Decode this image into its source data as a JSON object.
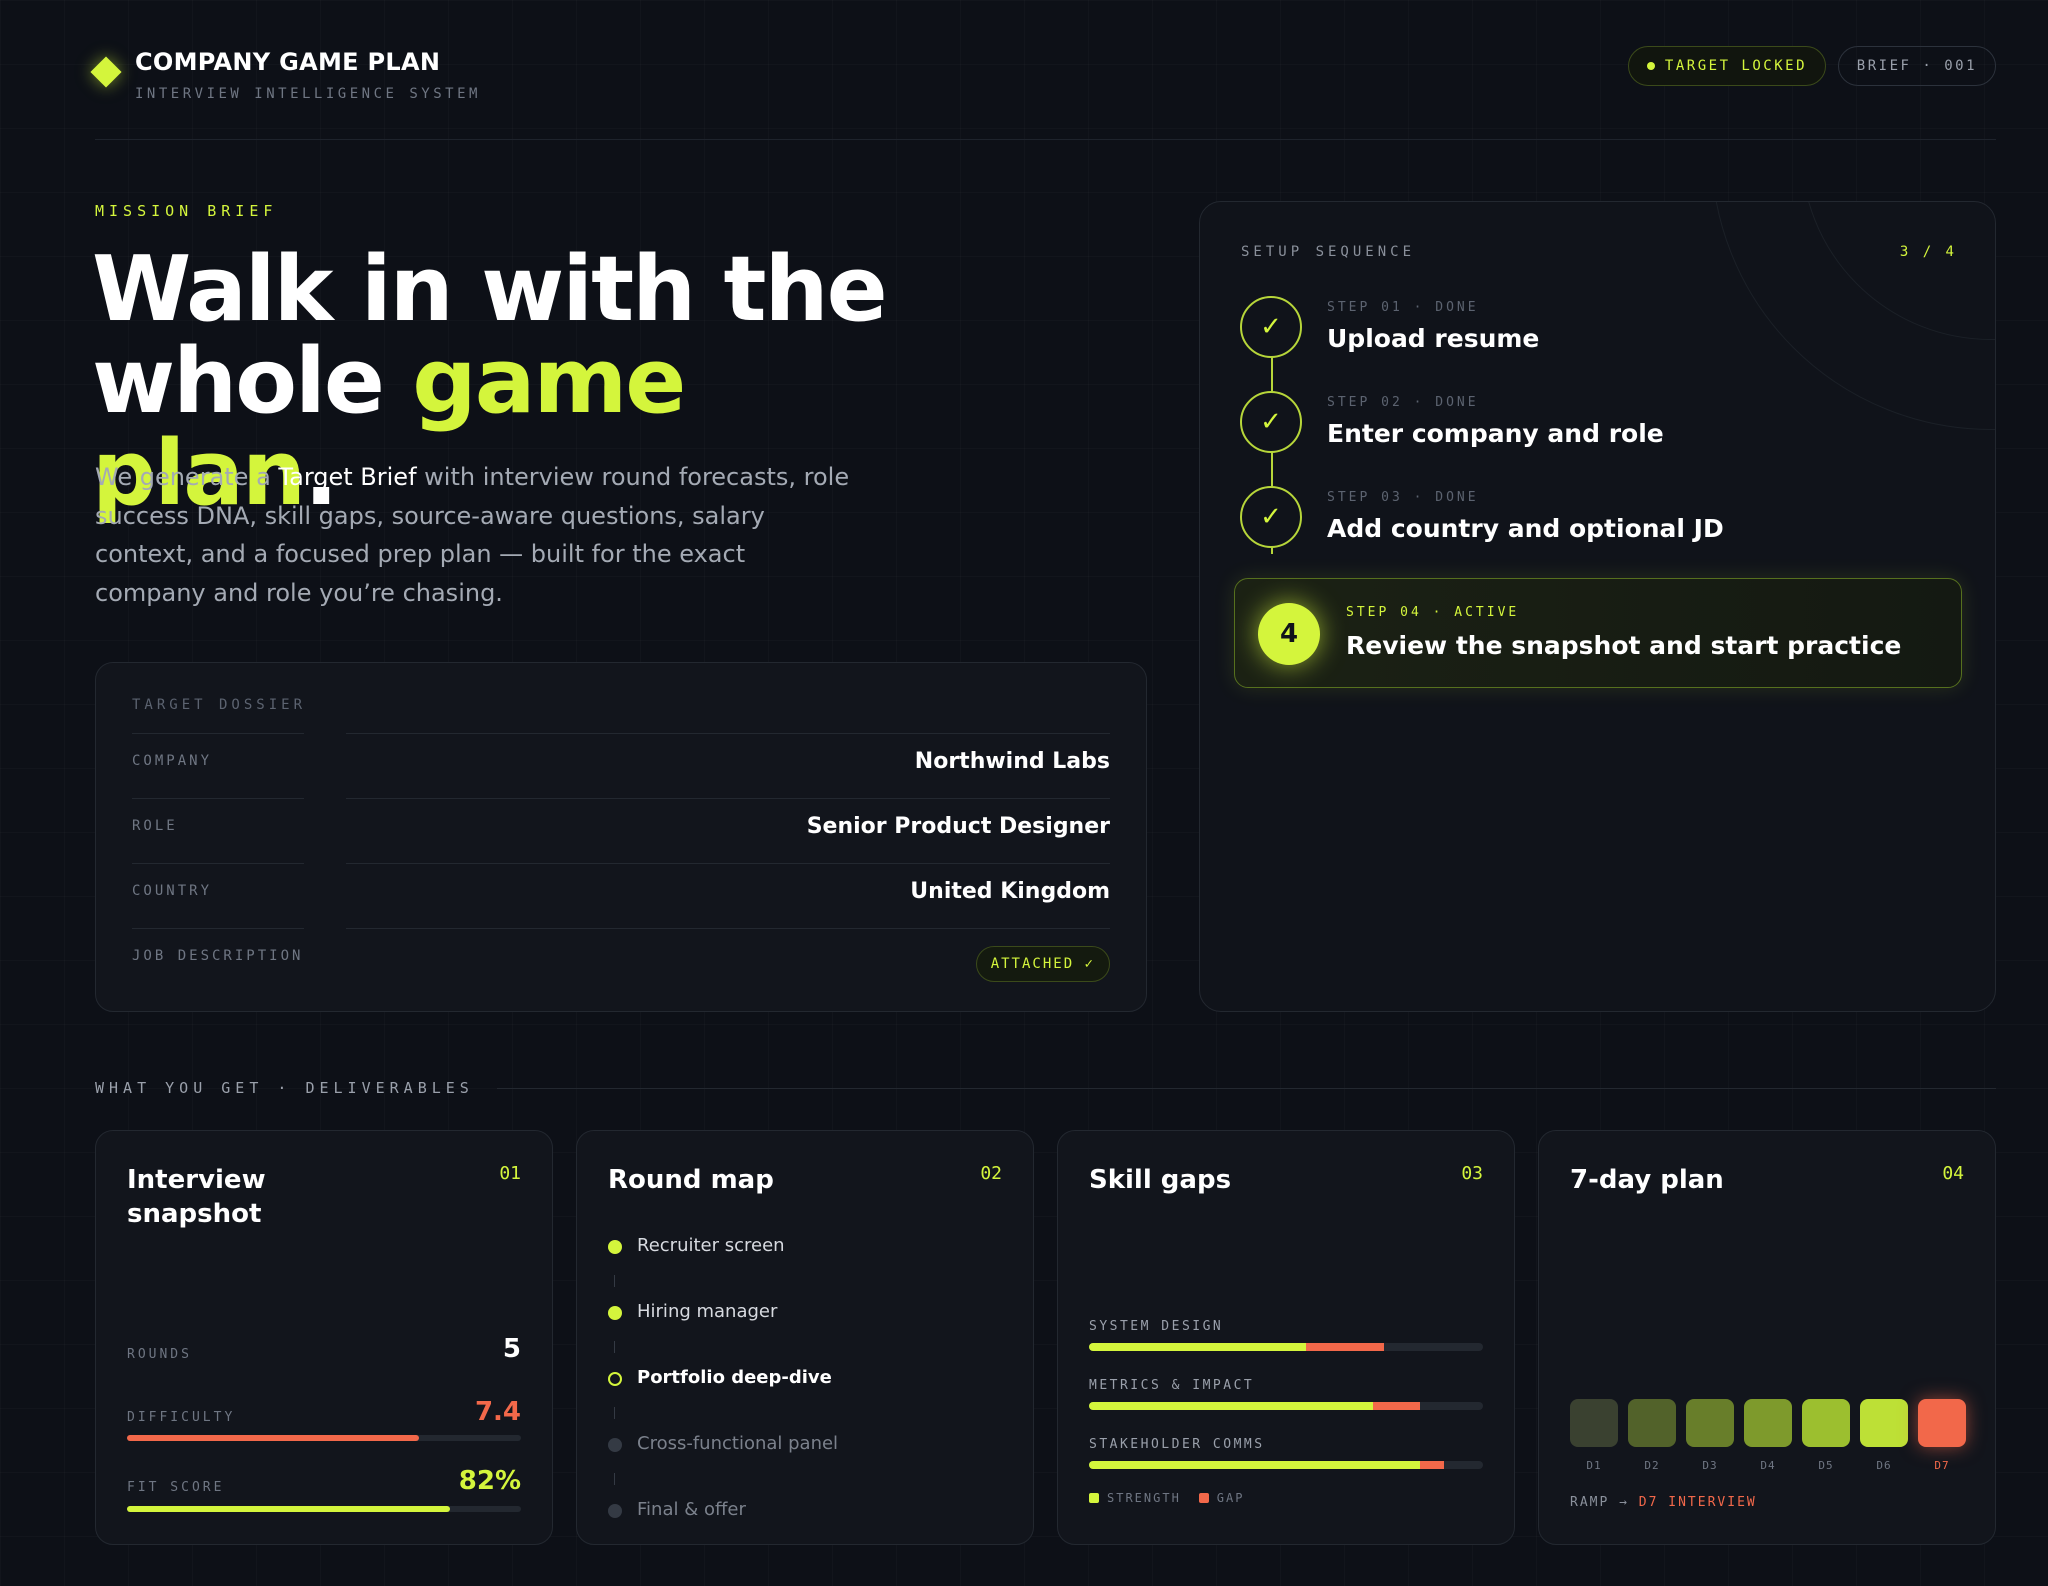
{
  "header": {
    "brand_title": "COMPANY GAME PLAN",
    "brand_subtitle": "INTERVIEW INTELLIGENCE SYSTEM",
    "status_pill": "TARGET LOCKED",
    "brief_pill": "BRIEF · 001"
  },
  "hero": {
    "eyebrow": "MISSION BRIEF",
    "headline_line1": "Walk in with the",
    "headline_line2_pre": "whole ",
    "headline_accent": "game plan",
    "headline_end": ".",
    "lede_pre": "We generate a ",
    "lede_strong": "Target Brief",
    "lede_post": " with interview round forecasts, role success DNA, skill gaps, source-aware questions, salary context, and a focused prep plan — built for the exact company and role you’re chasing."
  },
  "dossier": {
    "label": "TARGET DOSSIER",
    "rows": [
      {
        "key": "COMPANY",
        "value": "Northwind Labs"
      },
      {
        "key": "ROLE",
        "value": "Senior Product Designer"
      },
      {
        "key": "COUNTRY",
        "value": "United Kingdom"
      },
      {
        "key": "JOB DESCRIPTION",
        "value": "ATTACHED ✓"
      }
    ]
  },
  "setup": {
    "label": "SETUP SEQUENCE",
    "count": "3 / 4",
    "steps": [
      {
        "meta": "STEP 01 · DONE",
        "title": "Upload resume",
        "icon": "check-icon"
      },
      {
        "meta": "STEP 02 · DONE",
        "title": "Enter company and role",
        "icon": "check-icon"
      },
      {
        "meta": "STEP 03 · DONE",
        "title": "Add country and optional JD",
        "icon": "check-icon"
      }
    ],
    "active": {
      "number": "4",
      "meta": "STEP 04 · ACTIVE",
      "title": "Review the snapshot and start practice"
    }
  },
  "deliverables": {
    "heading": "WHAT YOU GET · DELIVERABLES",
    "snapshot": {
      "title": "Interview snapshot",
      "num": "01",
      "rounds_label": "ROUNDS",
      "rounds_value": "5",
      "difficulty_label": "DIFFICULTY",
      "difficulty_value": "7.4",
      "difficulty_fill": 0.74,
      "fit_label": "FIT SCORE",
      "fit_value": "82%",
      "fit_fill": 0.82
    },
    "round_map": {
      "title": "Round map",
      "num": "02",
      "rounds": [
        {
          "label": "Recruiter screen",
          "state": "done"
        },
        {
          "label": "Hiring manager",
          "state": "done"
        },
        {
          "label": "Portfolio deep-dive",
          "state": "current"
        },
        {
          "label": "Cross-functional panel",
          "state": "upcoming"
        },
        {
          "label": "Final & offer",
          "state": "upcoming"
        }
      ]
    },
    "skill_gaps": {
      "title": "Skill gaps",
      "num": "03",
      "skills": [
        {
          "label": "SYSTEM DESIGN",
          "strength": 0.55,
          "gap": 0.2
        },
        {
          "label": "METRICS & IMPACT",
          "strength": 0.72,
          "gap": 0.12
        },
        {
          "label": "STAKEHOLDER COMMS",
          "strength": 0.84,
          "gap": 0.06
        }
      ],
      "legend_strength": "STRENGTH",
      "legend_gap": "GAP"
    },
    "plan": {
      "title": "7-day plan",
      "num": "04",
      "days": [
        "D1",
        "D2",
        "D3",
        "D4",
        "D5",
        "D6",
        "D7"
      ],
      "ramp_pre": "RAMP → ",
      "ramp_target": "D7 INTERVIEW"
    }
  },
  "colors": {
    "accent": "#d4f53c",
    "alert": "#f2684a",
    "background": "#0d1017",
    "day_ramp": [
      "#3a4130",
      "#52622a",
      "#687e2a",
      "#7e9a2c",
      "#9cbf2f",
      "#bde036",
      "#f2684a"
    ]
  }
}
